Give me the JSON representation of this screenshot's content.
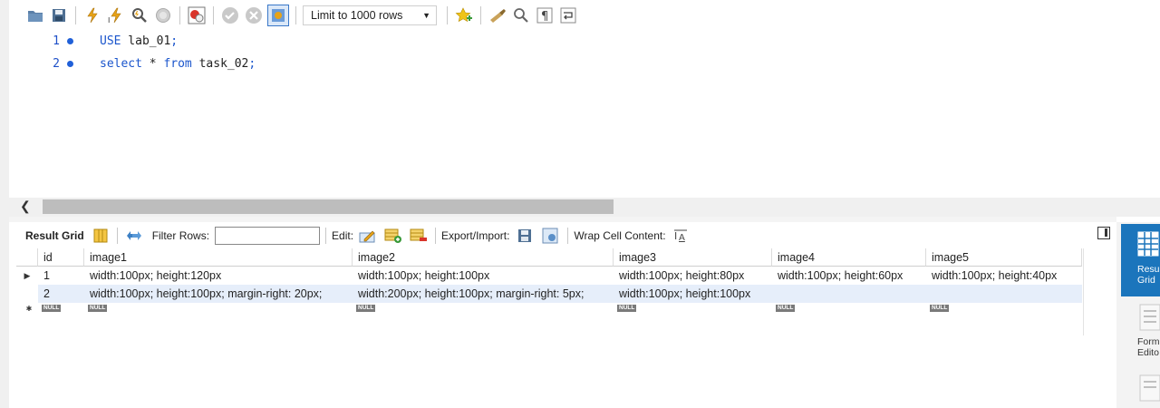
{
  "toolbar": {
    "limit_select": "Limit to 1000 rows",
    "icons": [
      "open-folder-icon",
      "save-icon",
      "execute-icon",
      "execute-current-icon",
      "explain-icon",
      "stop-icon",
      "toggle-error-icon",
      "commit-icon",
      "rollback-icon",
      "autocommit-icon",
      "bookmark-icon",
      "beautify-icon",
      "find-icon",
      "invisible-chars-icon",
      "wrap-icon"
    ]
  },
  "editor": {
    "lines": [
      {
        "number": "1",
        "kw": "USE",
        "rest": " lab_01",
        "end": ";"
      },
      {
        "number": "2",
        "kw": "select",
        "mid": " * ",
        "kw2": "from",
        "rest": " task_02",
        "end": ";"
      }
    ]
  },
  "result_toolbar": {
    "result_grid": "Result Grid",
    "filter_rows": "Filter Rows:",
    "filter_value": "",
    "edit": "Edit:",
    "export_import": "Export/Import:",
    "wrap_cell": "Wrap Cell Content:"
  },
  "grid": {
    "columns": [
      "id",
      "image1",
      "image2",
      "image3",
      "image4",
      "image5"
    ],
    "rows": [
      [
        "1",
        "width:100px; height:120px",
        "width:100px; height:100px",
        "width:100px; height:80px",
        "width:100px; height:60px",
        "width:100px; height:40px"
      ],
      [
        "2",
        "width:100px; height:100px; margin-right: 20px;",
        "width:200px; height:100px; margin-right: 5px;",
        "width:100px; height:100px",
        "",
        ""
      ]
    ],
    "null_label": "NULL"
  },
  "side_panel": {
    "result_grid_line1": "Resul",
    "result_grid_line2": "Grid",
    "form_editor_line1": "Form",
    "form_editor_line2": "Edito"
  },
  "colors": {
    "accent": "#1b75bc",
    "keyword": "#1a55cc",
    "selected_row": "#e6eefa"
  }
}
